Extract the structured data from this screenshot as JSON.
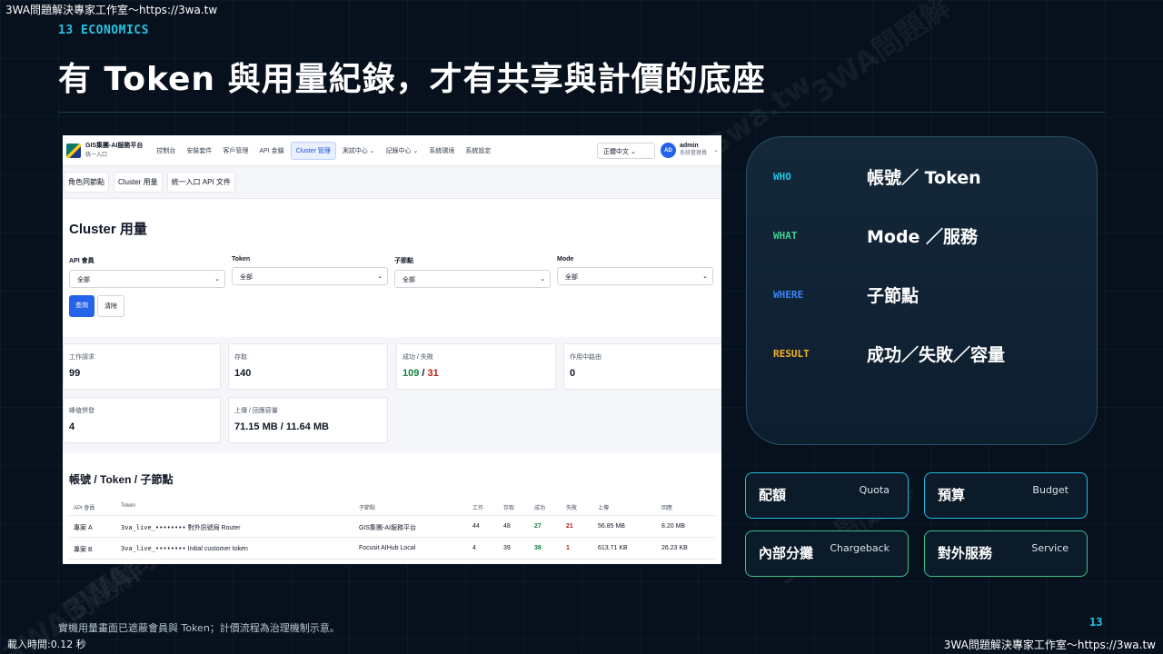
{
  "watermark": {
    "top_left": "3WA問題解決專家工作室～https://3wa.tw",
    "bottom_right": "3WA問題解決專家工作室～https://3wa.tw",
    "load_time": "載入時間:0.12 秒",
    "diagonal_1": "3WA問題解",
    "diagonal_2": "3WA問題解",
    "diagonal_3": "/3wa.tw",
    "diagonal_4": "3WA問題",
    "diagonal_5": "3WA問題解"
  },
  "slide": {
    "section_label": "13 ECONOMICS",
    "title": "有 Token 與用量紀錄，才有共享與計價的底座",
    "footnote": "實機用量畫面已遮蔽會員與 Token；計價流程為治理機制示意。",
    "page_number": "13"
  },
  "app": {
    "brand_title": "GIS集團-AI服務平台",
    "brand_subtitle": "統一入口",
    "nav": [
      {
        "label": "控制台"
      },
      {
        "label": "安裝套件"
      },
      {
        "label": "客戶管理"
      },
      {
        "label": "API 金鑰"
      },
      {
        "label": "Cluster 管理",
        "active": true
      },
      {
        "label": "測試中心 ⌄"
      },
      {
        "label": "記錄中心 ⌄"
      },
      {
        "label": "系統環境"
      },
      {
        "label": "系統設定"
      }
    ],
    "language": "正體中文 ⌄",
    "avatar_initials": "AD",
    "user_name": "admin",
    "user_role": "系統管理員",
    "subtabs": [
      "角色同節點",
      "Cluster 用量",
      "統一入口 API 文件"
    ],
    "page_heading": "Cluster 用量",
    "filters": [
      {
        "label": "API 會員",
        "value": "全部"
      },
      {
        "label": "Token",
        "value": "全部"
      },
      {
        "label": "子節點",
        "value": "全部"
      },
      {
        "label": "Mode",
        "value": "全部"
      }
    ],
    "query_button": "查詢",
    "clear_button": "清除",
    "stats": {
      "requests": {
        "label": "工作請求",
        "value": "99"
      },
      "access": {
        "label": "存取",
        "value": "140"
      },
      "success_fail": {
        "label": "成功 / 失敗",
        "success": "109",
        "sep": " / ",
        "fail": "31"
      },
      "active_routes": {
        "label": "作用中路由",
        "value": "0"
      },
      "peak": {
        "label": "峰值併發",
        "value": "4"
      },
      "traffic": {
        "label": "上傳 / 回應容量",
        "value": "71.15 MB / 11.64 MB"
      }
    },
    "table_heading": "帳號 / Token / 子節點",
    "table_headers": [
      "API 會員",
      "Token",
      "子節點",
      "工作",
      "存取",
      "成功",
      "失敗",
      "上傳",
      "回應"
    ],
    "rows": [
      {
        "member": "專案 A",
        "token": "3va_live_••••••••",
        "token_note": " 對外訊號局 Router",
        "node": "GIS集團-AI服務平台",
        "jobs": "44",
        "access": "48",
        "success": "27",
        "fail": "21",
        "upload": "56.85 MB",
        "response": "8.20 MB"
      },
      {
        "member": "專案 B",
        "token": "3va_live_••••••••",
        "token_note": " Initial customer token",
        "node": "Focusit AIHub Local",
        "jobs": "4",
        "access": "39",
        "success": "38",
        "fail": "1",
        "upload": "613.71 KB",
        "response": "26.23 KB"
      }
    ]
  },
  "dimensions": [
    {
      "key": "WHO",
      "value": "帳號／ Token",
      "color": "#23c4e4"
    },
    {
      "key": "WHAT",
      "value": "Mode ／服務",
      "color": "#3ed08f"
    },
    {
      "key": "WHERE",
      "value": "子節點",
      "color": "#3b82f6"
    },
    {
      "key": "RESULT",
      "value": "成功／失敗／容量",
      "color": "#f5b324"
    }
  ],
  "tiles": [
    {
      "zh": "配額",
      "en": "Quota"
    },
    {
      "zh": "預算",
      "en": "Budget"
    },
    {
      "zh": "內部分攤",
      "en": "Chargeback"
    },
    {
      "zh": "對外服務",
      "en": "Service"
    }
  ]
}
